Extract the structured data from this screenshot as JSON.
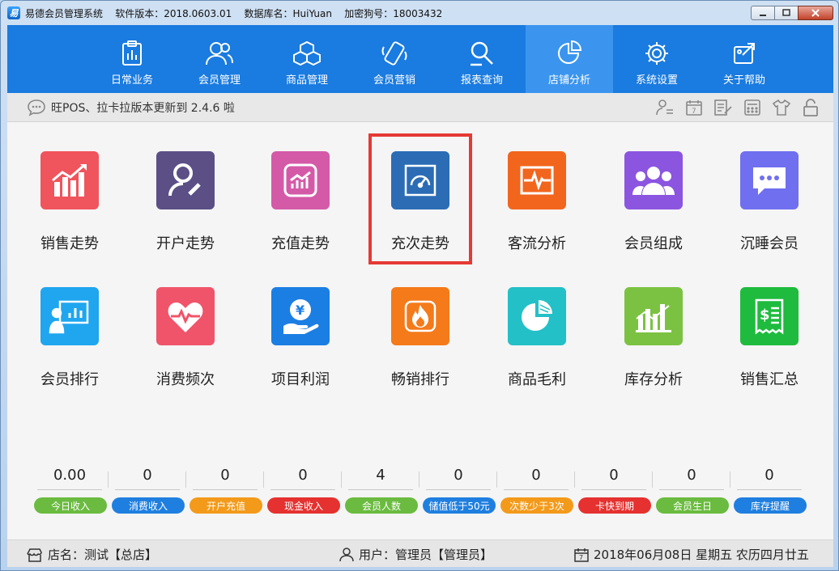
{
  "window": {
    "title": "易德会员管理系统    软件版本：2018.0603.01    数据库名：HuiYuan    加密狗号：18003432"
  },
  "nav": [
    {
      "label": "日常业务",
      "icon": "clipboard-icon"
    },
    {
      "label": "会员管理",
      "icon": "members-icon"
    },
    {
      "label": "商品管理",
      "icon": "boxes-icon"
    },
    {
      "label": "会员营销",
      "icon": "phone-icon"
    },
    {
      "label": "报表查询",
      "icon": "search-report-icon"
    },
    {
      "label": "店铺分析",
      "icon": "pie-chart-icon",
      "active": true
    },
    {
      "label": "系统设置",
      "icon": "gear-icon"
    },
    {
      "label": "关于帮助",
      "icon": "help-icon"
    }
  ],
  "notice": {
    "text": "旺POS、拉卡拉版本更新到 2.4.6 啦"
  },
  "tiles": [
    {
      "label": "销售走势",
      "color": "#f0545d"
    },
    {
      "label": "开户走势",
      "color": "#5b4f86"
    },
    {
      "label": "充值走势",
      "color": "#d45aa8"
    },
    {
      "label": "充次走势",
      "color": "#2b6cb5"
    },
    {
      "label": "客流分析",
      "color": "#f2651d"
    },
    {
      "label": "会员组成",
      "color": "#8b55e0"
    },
    {
      "label": "沉睡会员",
      "color": "#6f6ff0"
    },
    {
      "label": "会员排行",
      "color": "#1fa6ef"
    },
    {
      "label": "消费频次",
      "color": "#f0546a"
    },
    {
      "label": "项目利润",
      "color": "#1b7ee3"
    },
    {
      "label": "畅销排行",
      "color": "#f57a1a"
    },
    {
      "label": "商品毛利",
      "color": "#23c0c7"
    },
    {
      "label": "库存分析",
      "color": "#7cc242"
    },
    {
      "label": "销售汇总",
      "color": "#1fbb3e"
    }
  ],
  "stats": [
    {
      "value": "0.00",
      "label": "今日收入",
      "color": "#6abb3f"
    },
    {
      "value": "0",
      "label": "消费收入",
      "color": "#1f7fe0"
    },
    {
      "value": "0",
      "label": "开户充值",
      "color": "#f39a1a"
    },
    {
      "value": "0",
      "label": "现金收入",
      "color": "#e5312f"
    },
    {
      "value": "4",
      "label": "会员人数",
      "color": "#6abb3f"
    },
    {
      "value": "0",
      "label": "储值低于50元",
      "color": "#1f7fe0"
    },
    {
      "value": "0",
      "label": "次数少于3次",
      "color": "#f39a1a"
    },
    {
      "value": "0",
      "label": "卡快到期",
      "color": "#e5312f"
    },
    {
      "value": "0",
      "label": "会员生日",
      "color": "#6abb3f"
    },
    {
      "value": "0",
      "label": "库存提醒",
      "color": "#1f7fe0"
    }
  ],
  "status": {
    "store": "店名：测试【总店】",
    "user": "用户：管理员【管理员】",
    "date": "2018年06月08日 星期五 农历四月廿五"
  }
}
